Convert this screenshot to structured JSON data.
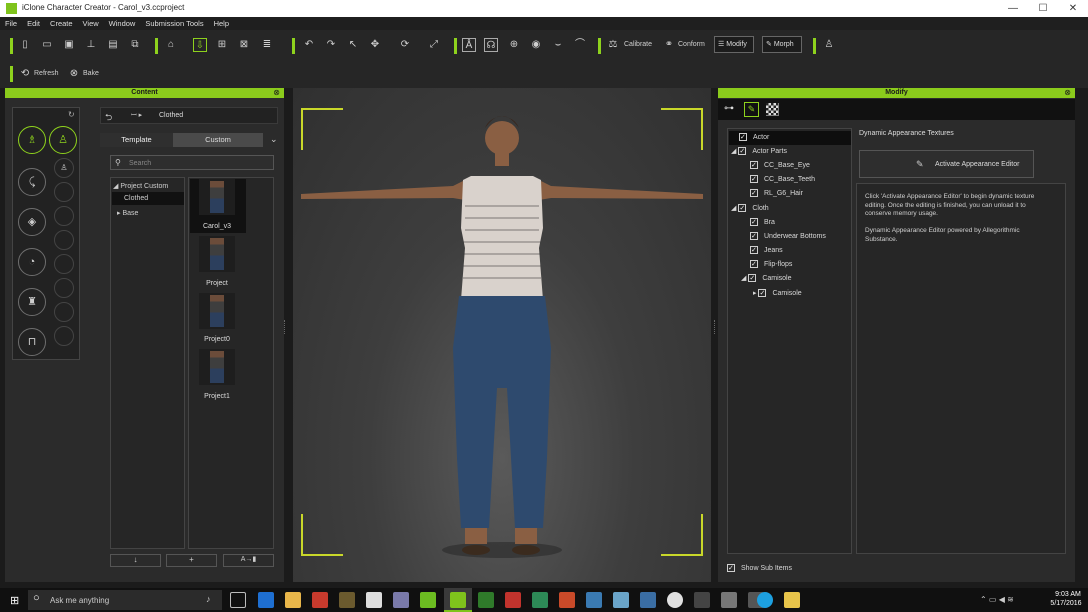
{
  "window": {
    "title": "iClone Character Creator - Carol_v3.ccproject",
    "minimize": "—",
    "maximize": "☐",
    "close": "✕"
  },
  "menu": [
    "File",
    "Edit",
    "Create",
    "View",
    "Window",
    "Submission Tools",
    "Help"
  ],
  "toolbar": {
    "calibrate": "Calibrate",
    "conform": "Conform",
    "modify": "Modify",
    "morph": "Morph",
    "refresh": "Refresh",
    "bake": "Bake"
  },
  "content": {
    "header": "Content",
    "breadcrumb": "Clothed",
    "tabs": [
      "Template",
      "Custom"
    ],
    "search_placeholder": "Search",
    "tree": [
      "Project Custom",
      "Clothed",
      "Base"
    ],
    "thumbs": [
      "Carol_v3",
      "Project",
      "Project0",
      "Project1"
    ]
  },
  "modify": {
    "header": "Modify",
    "section_title": "Dynamic Appearance Textures",
    "activate_button": "Activate Appearance Editor",
    "info1": "Click 'Activate Appearance Editor' to begin dynamic texture editing.  Once the editing is finished, you can unload it to conserve memory usage.",
    "info2": "Dynamic Appearance Editor powered by Allegorithmic Substance.",
    "tree": [
      "Actor",
      "Actor Parts",
      "CC_Base_Eye",
      "CC_Base_Teeth",
      "RL_G6_Hair",
      "Cloth",
      "Bra",
      "Underwear Bottoms",
      "Jeans",
      "Flip-flops",
      "Camisole",
      "Camisole"
    ],
    "show_sub_items": "Show Sub Items"
  },
  "taskbar": {
    "search": "Ask me anything",
    "time": "9:03 AM",
    "date": "5/17/2016"
  },
  "colors": {
    "accent": "#8bcb1c"
  }
}
